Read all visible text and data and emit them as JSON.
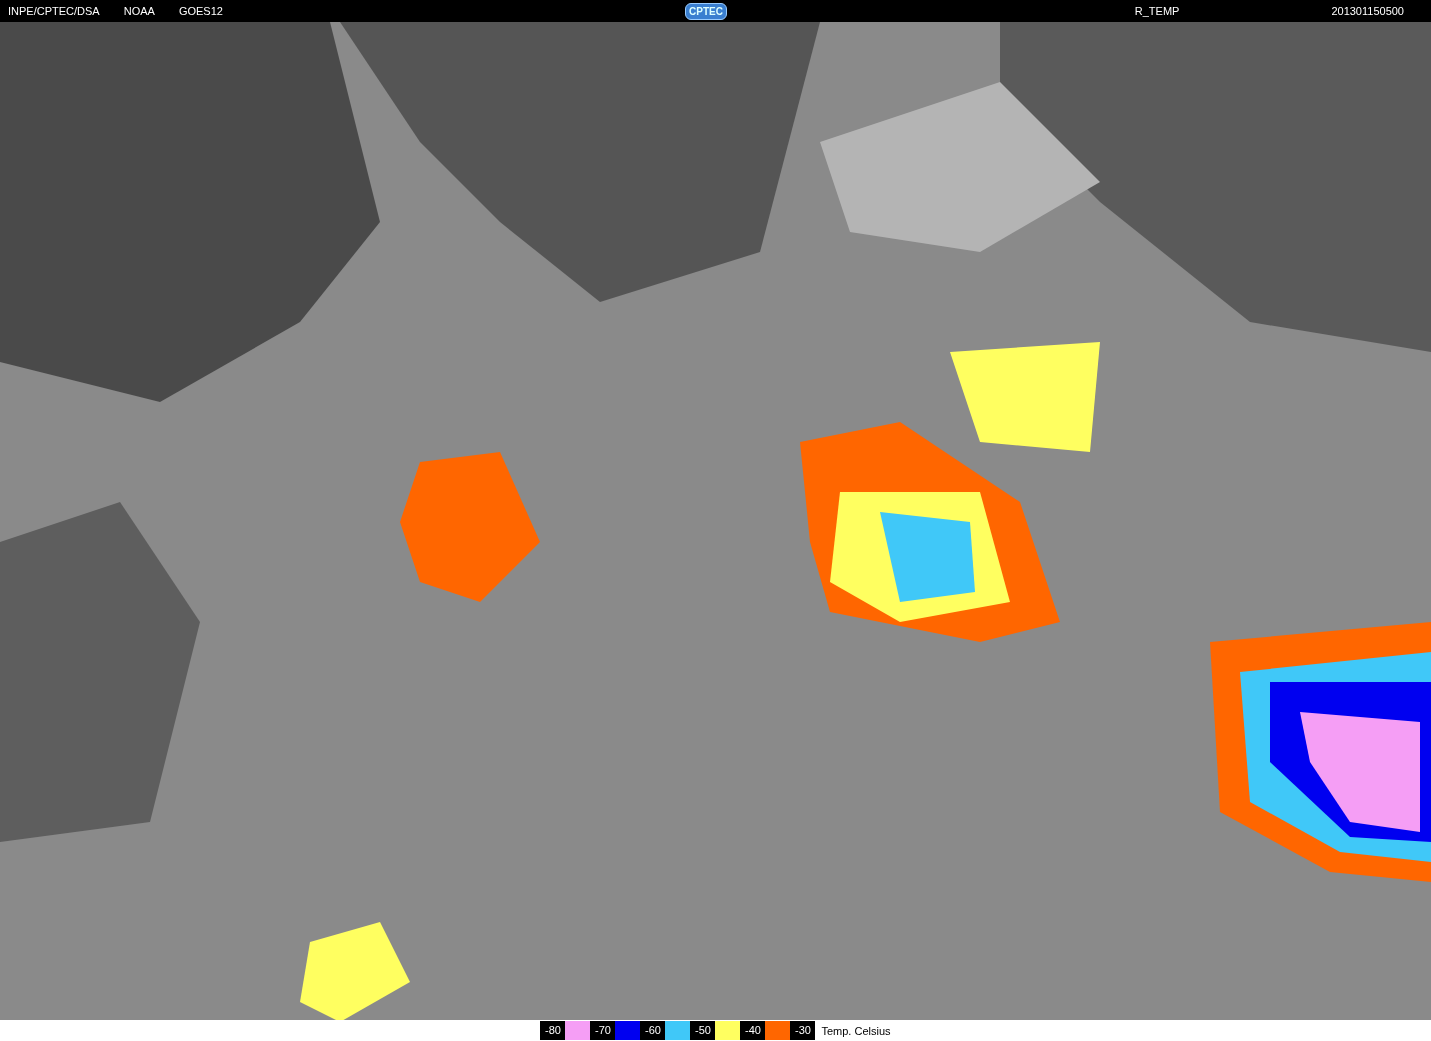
{
  "header": {
    "left": [
      "INPE/CPTEC/DSA",
      "NOAA",
      "GOES12"
    ],
    "logo": "CPTEC",
    "product": "R_TEMP",
    "timestamp": "201301150500"
  },
  "legend": {
    "items": [
      {
        "label": "-80",
        "color": "#f59ef5"
      },
      {
        "label": "-70",
        "color": "#0000f0"
      },
      {
        "label": "-60",
        "color": "#40c8f8"
      },
      {
        "label": "-50",
        "color": "#ffff60"
      },
      {
        "label": "-40",
        "color": "#ff6600"
      },
      {
        "label": "-30"
      }
    ],
    "unit": "Temp. Celsius"
  }
}
